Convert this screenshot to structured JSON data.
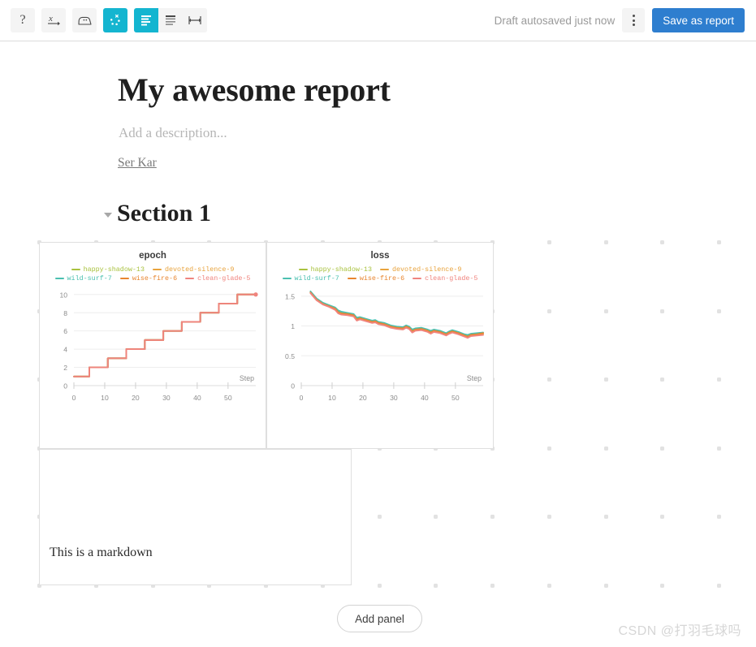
{
  "toolbar": {
    "buttons": [
      {
        "name": "help-icon",
        "label": "?",
        "active": false
      },
      {
        "name": "equation-icon",
        "label": "x",
        "active": false
      },
      {
        "name": "iron-icon",
        "label": "iron",
        "active": false
      },
      {
        "name": "scatter-plot-icon",
        "label": "scatter",
        "active": true
      }
    ],
    "group_buttons": [
      {
        "name": "align-panel-icon",
        "label": "panel-grid",
        "active": true
      },
      {
        "name": "align-list-icon",
        "label": "list",
        "active": false
      },
      {
        "name": "width-resize-icon",
        "label": "width",
        "active": false
      }
    ],
    "autosave_text": "Draft autosaved just now",
    "kebab_label": "More options",
    "save_label": "Save as report",
    "save_color": "#2e7ecf",
    "accent_color": "#14b5d0"
  },
  "document": {
    "title": "My awesome report",
    "description_placeholder": "Add a description...",
    "author": "Ser Kar",
    "section_title": "Section 1"
  },
  "panels": {
    "markdown": {
      "text": "This is a markdown"
    }
  },
  "footer": {
    "add_panel_label": "Add panel",
    "watermark": "CSDN @打羽毛球吗"
  },
  "series_colors": {
    "happy-shadow-13": "#a9c23f",
    "devoted-silence-9": "#e8a33d",
    "wild-surf-7": "#4bc0b0",
    "wise-fire-6": "#e8852f",
    "clean-glade-5": "#f0847e"
  },
  "chart_data": [
    {
      "type": "line",
      "title": "epoch",
      "xlabel": "Step",
      "ylabel": "",
      "xlim": [
        0,
        59
      ],
      "ylim": [
        0,
        10.6
      ],
      "xticks": [
        0,
        10,
        20,
        30,
        40,
        50
      ],
      "yticks": [
        0,
        2,
        4,
        6,
        8,
        10
      ],
      "grid": true,
      "legend_position": "top",
      "legend": [
        "happy-shadow-13",
        "devoted-silence-9",
        "wild-surf-7",
        "wise-fire-6",
        "clean-glade-5"
      ],
      "series": [
        {
          "name": "happy-shadow-13",
          "color": "#a9c23f",
          "x": [
            0,
            5,
            5,
            11,
            11,
            17,
            17,
            23,
            23,
            29,
            29,
            35,
            35,
            41,
            41,
            47,
            47,
            53,
            53,
            59
          ],
          "values": [
            1,
            1,
            2,
            2,
            3,
            3,
            4,
            4,
            5,
            5,
            6,
            6,
            7,
            7,
            8,
            8,
            9,
            9,
            10,
            10
          ]
        },
        {
          "name": "devoted-silence-9",
          "color": "#e8a33d",
          "x": [
            0,
            5,
            5,
            11,
            11,
            17,
            17,
            23,
            23,
            29,
            29,
            35,
            35,
            41,
            41,
            47,
            47,
            53,
            53,
            59
          ],
          "values": [
            1,
            1,
            2,
            2,
            3,
            3,
            4,
            4,
            5,
            5,
            6,
            6,
            7,
            7,
            8,
            8,
            9,
            9,
            10,
            10
          ]
        },
        {
          "name": "wild-surf-7",
          "color": "#4bc0b0",
          "x": [
            0,
            5,
            5,
            11,
            11,
            17,
            17,
            23,
            23,
            29,
            29,
            35,
            35,
            41,
            41,
            47,
            47,
            53,
            53,
            59
          ],
          "values": [
            1,
            1,
            2,
            2,
            3,
            3,
            4,
            4,
            5,
            5,
            6,
            6,
            7,
            7,
            8,
            8,
            9,
            9,
            10,
            10
          ]
        },
        {
          "name": "wise-fire-6",
          "color": "#e8852f",
          "x": [
            0,
            5,
            5,
            11,
            11,
            17,
            17,
            23,
            23,
            29,
            29,
            35,
            35,
            41,
            41,
            47,
            47,
            53,
            53,
            59
          ],
          "values": [
            1,
            1,
            2,
            2,
            3,
            3,
            4,
            4,
            5,
            5,
            6,
            6,
            7,
            7,
            8,
            8,
            9,
            9,
            10,
            10
          ]
        },
        {
          "name": "clean-glade-5",
          "color": "#f0847e",
          "x": [
            0,
            5,
            5,
            11,
            11,
            17,
            17,
            23,
            23,
            29,
            29,
            35,
            35,
            41,
            41,
            47,
            47,
            53,
            53,
            59
          ],
          "values": [
            1,
            1,
            2,
            2,
            3,
            3,
            4,
            4,
            5,
            5,
            6,
            6,
            7,
            7,
            8,
            8,
            9,
            9,
            10,
            10
          ],
          "endpoint_marker": {
            "x": 59,
            "y": 10
          }
        }
      ]
    },
    {
      "type": "line",
      "title": "loss",
      "xlabel": "Step",
      "ylabel": "",
      "xlim": [
        0,
        59
      ],
      "ylim": [
        0,
        1.62
      ],
      "xticks": [
        0,
        10,
        20,
        30,
        40,
        50
      ],
      "yticks": [
        0,
        0.5,
        1,
        1.5
      ],
      "grid": true,
      "legend_position": "top",
      "legend": [
        "happy-shadow-13",
        "devoted-silence-9",
        "wild-surf-7",
        "wise-fire-6",
        "clean-glade-5"
      ],
      "series": [
        {
          "name": "happy-shadow-13",
          "color": "#a9c23f",
          "x": [
            3,
            5,
            7,
            9,
            11,
            12,
            13,
            15,
            17,
            18,
            19,
            21,
            23,
            24,
            25,
            27,
            29,
            30,
            31,
            33,
            34,
            35,
            36,
            37,
            39,
            41,
            42,
            43,
            45,
            47,
            48,
            49,
            51,
            53,
            54,
            55,
            57,
            59
          ],
          "values": [
            1.57,
            1.45,
            1.38,
            1.34,
            1.3,
            1.24,
            1.22,
            1.21,
            1.19,
            1.12,
            1.14,
            1.11,
            1.08,
            1.09,
            1.06,
            1.04,
            1.0,
            0.99,
            0.98,
            0.97,
            1.0,
            0.98,
            0.92,
            0.95,
            0.96,
            0.93,
            0.9,
            0.93,
            0.91,
            0.87,
            0.9,
            0.92,
            0.89,
            0.85,
            0.83,
            0.86,
            0.87,
            0.88
          ]
        },
        {
          "name": "devoted-silence-9",
          "color": "#e8a33d",
          "x": [
            3,
            5,
            7,
            9,
            11,
            12,
            13,
            15,
            17,
            18,
            19,
            21,
            23,
            24,
            25,
            27,
            29,
            30,
            31,
            33,
            34,
            35,
            36,
            37,
            39,
            41,
            42,
            43,
            45,
            47,
            48,
            49,
            51,
            53,
            54,
            55,
            57,
            59
          ],
          "values": [
            1.56,
            1.44,
            1.37,
            1.33,
            1.28,
            1.22,
            1.2,
            1.19,
            1.17,
            1.1,
            1.12,
            1.09,
            1.06,
            1.07,
            1.04,
            1.02,
            0.98,
            0.97,
            0.96,
            0.95,
            0.98,
            0.96,
            0.9,
            0.93,
            0.94,
            0.91,
            0.88,
            0.91,
            0.89,
            0.85,
            0.88,
            0.9,
            0.87,
            0.83,
            0.81,
            0.84,
            0.85,
            0.87
          ]
        },
        {
          "name": "wild-surf-7",
          "color": "#4bc0b0",
          "x": [
            3,
            5,
            7,
            9,
            11,
            12,
            13,
            15,
            17,
            18,
            19,
            21,
            23,
            24,
            25,
            27,
            29,
            30,
            31,
            33,
            34,
            35,
            36,
            37,
            39,
            41,
            42,
            43,
            45,
            47,
            48,
            49,
            51,
            53,
            54,
            55,
            57,
            59
          ],
          "values": [
            1.58,
            1.46,
            1.39,
            1.35,
            1.31,
            1.26,
            1.24,
            1.22,
            1.2,
            1.14,
            1.15,
            1.12,
            1.09,
            1.1,
            1.07,
            1.05,
            1.01,
            1.0,
            0.99,
            0.98,
            1.01,
            0.99,
            0.94,
            0.96,
            0.97,
            0.94,
            0.92,
            0.94,
            0.92,
            0.88,
            0.91,
            0.93,
            0.9,
            0.86,
            0.85,
            0.87,
            0.88,
            0.89
          ]
        },
        {
          "name": "wise-fire-6",
          "color": "#e8852f",
          "x": [
            3,
            5,
            7,
            9,
            11,
            12,
            13,
            15,
            17,
            18,
            19,
            21,
            23,
            24,
            25,
            27,
            29,
            30,
            31,
            33,
            34,
            35,
            36,
            37,
            39,
            41,
            42,
            43,
            45,
            47,
            48,
            49,
            51,
            53,
            54,
            55,
            57,
            59
          ],
          "values": [
            1.56,
            1.44,
            1.37,
            1.33,
            1.29,
            1.23,
            1.21,
            1.2,
            1.18,
            1.11,
            1.13,
            1.1,
            1.07,
            1.08,
            1.05,
            1.03,
            0.99,
            0.98,
            0.97,
            0.96,
            0.99,
            0.97,
            0.91,
            0.94,
            0.95,
            0.92,
            0.89,
            0.92,
            0.9,
            0.86,
            0.89,
            0.91,
            0.88,
            0.84,
            0.82,
            0.85,
            0.86,
            0.88
          ]
        },
        {
          "name": "clean-glade-5",
          "color": "#f0847e",
          "x": [
            3,
            5,
            7,
            9,
            11,
            12,
            13,
            15,
            17,
            18,
            19,
            21,
            23,
            24,
            25,
            27,
            29,
            30,
            31,
            33,
            34,
            35,
            36,
            37,
            39,
            41,
            42,
            43,
            45,
            47,
            48,
            49,
            51,
            53,
            54,
            55,
            57,
            59
          ],
          "values": [
            1.55,
            1.43,
            1.36,
            1.32,
            1.27,
            1.21,
            1.19,
            1.18,
            1.16,
            1.09,
            1.11,
            1.08,
            1.05,
            1.06,
            1.03,
            1.01,
            0.97,
            0.96,
            0.95,
            0.94,
            0.97,
            0.95,
            0.89,
            0.92,
            0.93,
            0.9,
            0.87,
            0.9,
            0.88,
            0.84,
            0.87,
            0.89,
            0.86,
            0.82,
            0.8,
            0.83,
            0.84,
            0.85
          ]
        }
      ]
    }
  ]
}
